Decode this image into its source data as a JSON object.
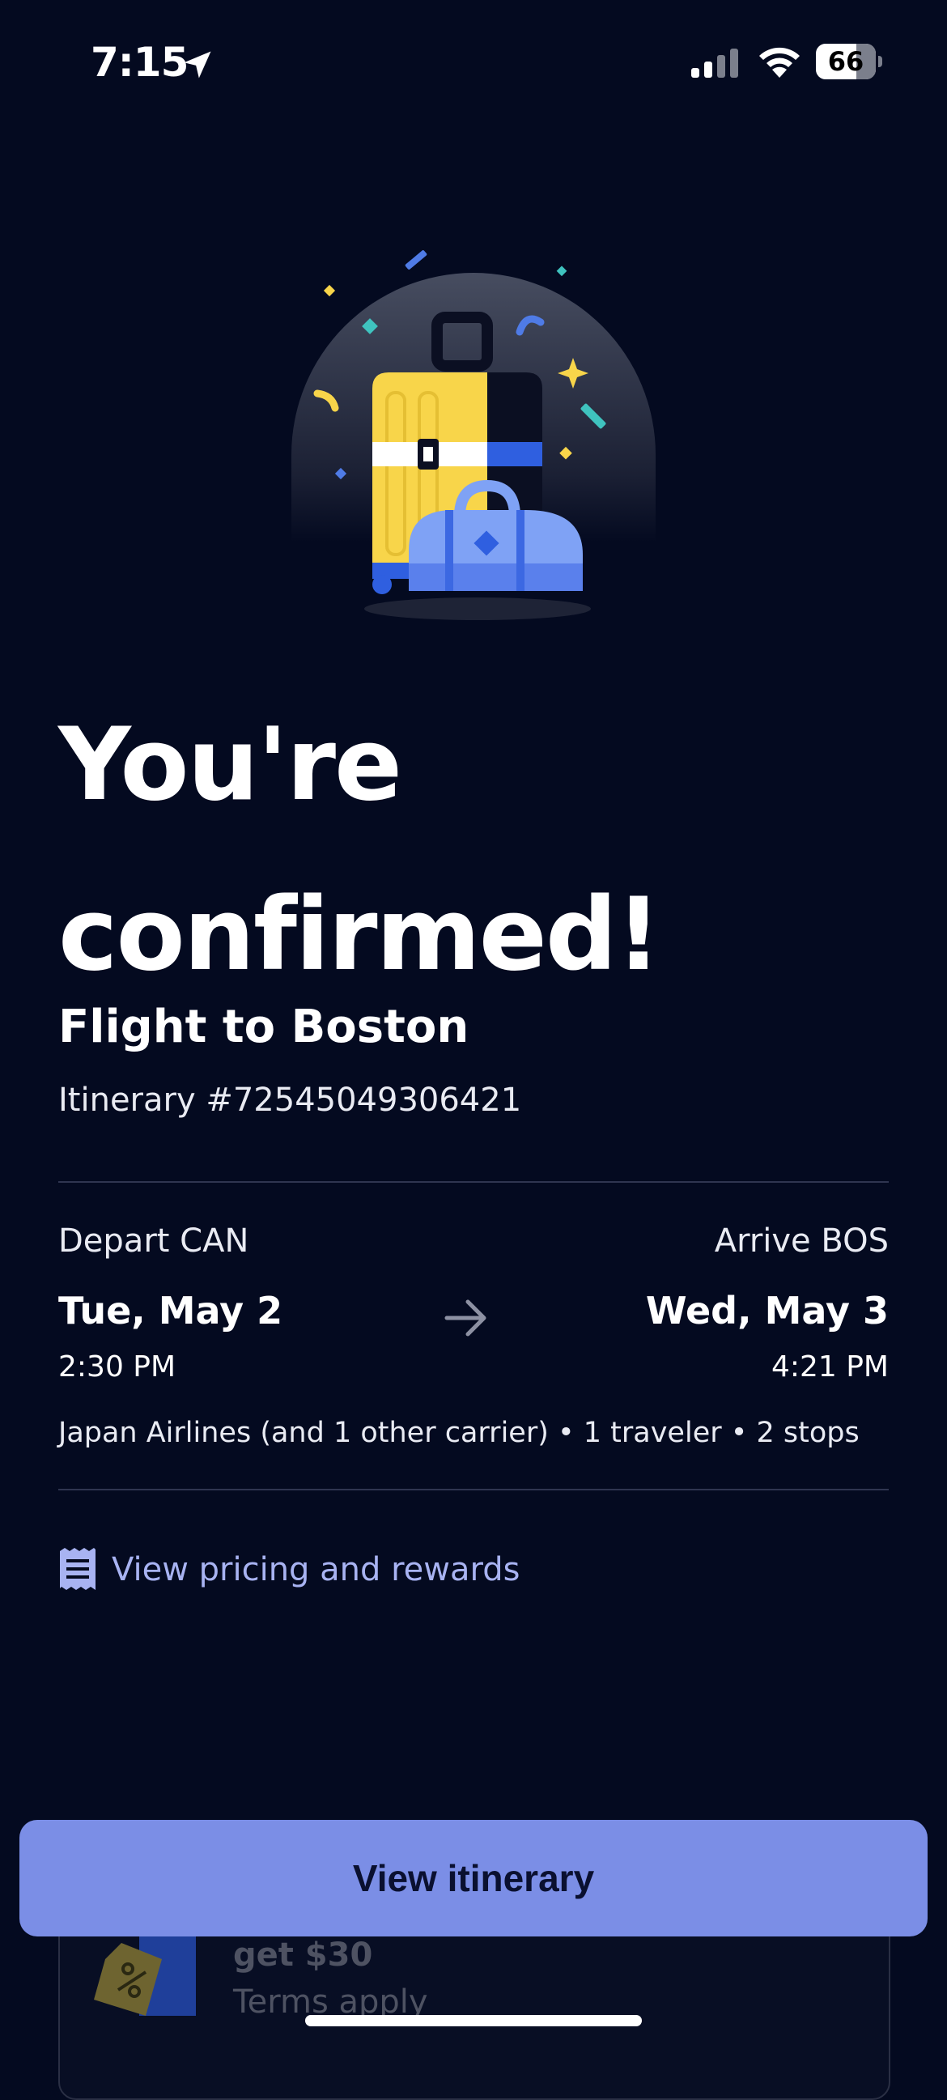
{
  "status_bar": {
    "time": "7:15",
    "battery": "66",
    "icons": [
      "location-arrow-icon",
      "cellular-signal-icon",
      "wifi-icon",
      "battery-icon"
    ]
  },
  "confirmation": {
    "headline_line1": "You're",
    "headline_line2": "confirmed!",
    "flight_title": "Flight to Boston",
    "itinerary_number": "Itinerary #72545049306421"
  },
  "trip": {
    "depart_label": "Depart CAN",
    "depart_date": "Tue, May 2",
    "depart_time": "2:30 PM",
    "arrive_label": "Arrive BOS",
    "arrive_date": "Wed, May 3",
    "arrive_time": "4:21 PM",
    "summary": "Japan Airlines (and 1 other carrier) • 1 traveler • 2 stops"
  },
  "links": {
    "pricing": "View pricing and rewards",
    "pricing_icon": "receipt-icon"
  },
  "promo": {
    "title": "get $30",
    "subtitle": "Terms apply",
    "icon": "discount-tag-icon"
  },
  "cta": {
    "label": "View itinerary"
  },
  "colors": {
    "background": "#040a20",
    "accent": "#7b8ee6",
    "link": "#a8b3f2",
    "suitcase_yellow": "#f8d54a",
    "bag_blue": "#7fa2f5"
  }
}
